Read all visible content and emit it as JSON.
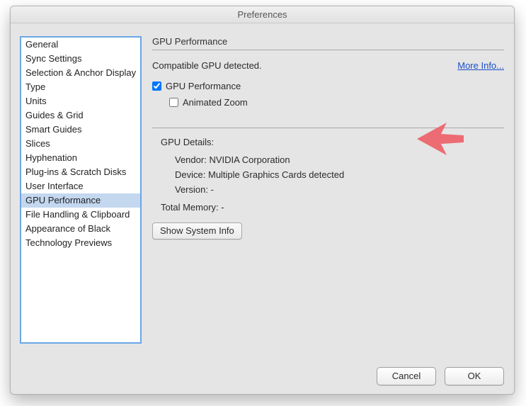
{
  "window": {
    "title": "Preferences"
  },
  "sidebar": {
    "items": [
      {
        "label": "General"
      },
      {
        "label": "Sync Settings"
      },
      {
        "label": "Selection & Anchor Display"
      },
      {
        "label": "Type"
      },
      {
        "label": "Units"
      },
      {
        "label": "Guides & Grid"
      },
      {
        "label": "Smart Guides"
      },
      {
        "label": "Slices"
      },
      {
        "label": "Hyphenation"
      },
      {
        "label": "Plug-ins & Scratch Disks"
      },
      {
        "label": "User Interface"
      },
      {
        "label": "GPU Performance"
      },
      {
        "label": "File Handling & Clipboard"
      },
      {
        "label": "Appearance of Black"
      },
      {
        "label": "Technology Previews"
      }
    ],
    "selected_index": 11
  },
  "main": {
    "section_header": "GPU Performance",
    "status_text": "Compatible GPU detected.",
    "more_info": "More Info...",
    "checkboxes": {
      "gpu_perf": {
        "label": "GPU Performance",
        "checked": true
      },
      "anim_zoom": {
        "label": "Animated Zoom",
        "checked": false
      }
    },
    "details_label": "GPU Details:",
    "vendor_label": "Vendor:",
    "vendor_value": "NVIDIA Corporation",
    "device_label": "Device:",
    "device_value": "Multiple Graphics Cards detected",
    "version_label": "Version:",
    "version_value": "-",
    "total_memory_label": "Total Memory:",
    "total_memory_value": "-",
    "sysinfo_button": "Show System Info"
  },
  "footer": {
    "cancel": "Cancel",
    "ok": "OK"
  },
  "annotation": {
    "arrow_color": "#ed6b73"
  }
}
